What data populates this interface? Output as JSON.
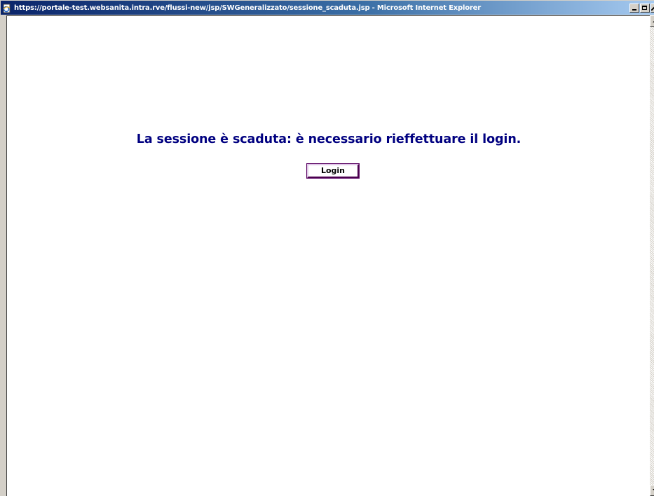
{
  "window": {
    "title": "https://portale-test.websanita.intra.rve/flussi-new/jsp/SWGeneralizzato/sessione_scaduta.jsp - Microsoft Internet Explorer",
    "icon": "ie-page-icon",
    "controls": [
      "minimize",
      "maximize",
      "close"
    ]
  },
  "page": {
    "message": "La sessione è scaduta: è necessario rieffettuare il login.",
    "login_button_label": "Login"
  },
  "colors": {
    "message_text": "#000080",
    "button_border": "#5e0a67",
    "titlebar_start": "#0a246a",
    "titlebar_end": "#a6caf0",
    "background": "#ffffff"
  }
}
